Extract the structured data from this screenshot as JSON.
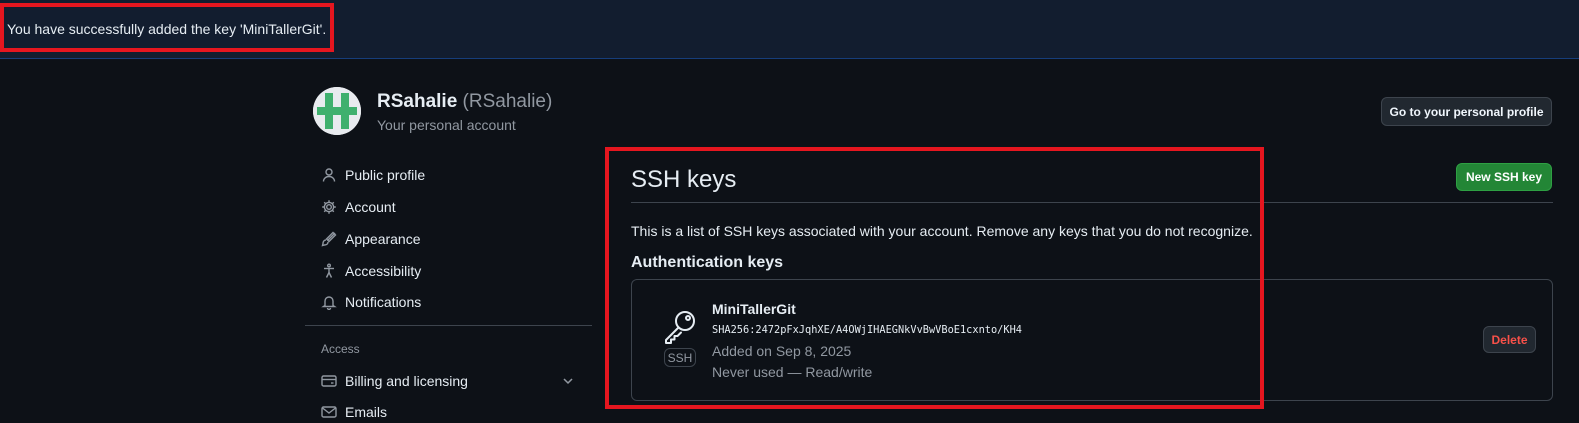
{
  "flash": {
    "message": "You have successfully added the key 'MiniTallerGit'."
  },
  "user": {
    "name": "RSahalie",
    "login": "(RSahalie)",
    "subtitle": "Your personal account",
    "profile_button": "Go to your personal profile"
  },
  "sidebar": {
    "items": [
      {
        "label": "Public profile",
        "icon": "person-icon"
      },
      {
        "label": "Account",
        "icon": "gear-icon"
      },
      {
        "label": "Appearance",
        "icon": "paintbrush-icon"
      },
      {
        "label": "Accessibility",
        "icon": "accessibility-icon"
      },
      {
        "label": "Notifications",
        "icon": "bell-icon"
      }
    ],
    "section_label": "Access",
    "access_items": [
      {
        "label": "Billing and licensing",
        "icon": "credit-card-icon"
      },
      {
        "label": "Emails",
        "icon": "mail-icon"
      }
    ]
  },
  "main": {
    "title": "SSH keys",
    "new_key_button": "New SSH key",
    "intro": "This is a list of SSH keys associated with your account. Remove any keys that you do not recognize.",
    "section_heading": "Authentication keys",
    "keys": [
      {
        "title": "MiniTallerGit",
        "fingerprint": "SHA256:2472pFxJqhXE/A4OWjIHAEGNkVvBwVBoE1cxnto/KH4",
        "added": "Added on Sep 8, 2025",
        "usage": "Never used — Read/write",
        "type": "SSH",
        "delete_label": "Delete"
      }
    ]
  },
  "colors": {
    "background": "#0d1117",
    "flash_background": "#121d2f",
    "primary_button": "#238636",
    "danger_text": "#f85149",
    "highlight_box": "#e5161f",
    "muted_text": "#9198a1",
    "border": "#3d444d"
  }
}
